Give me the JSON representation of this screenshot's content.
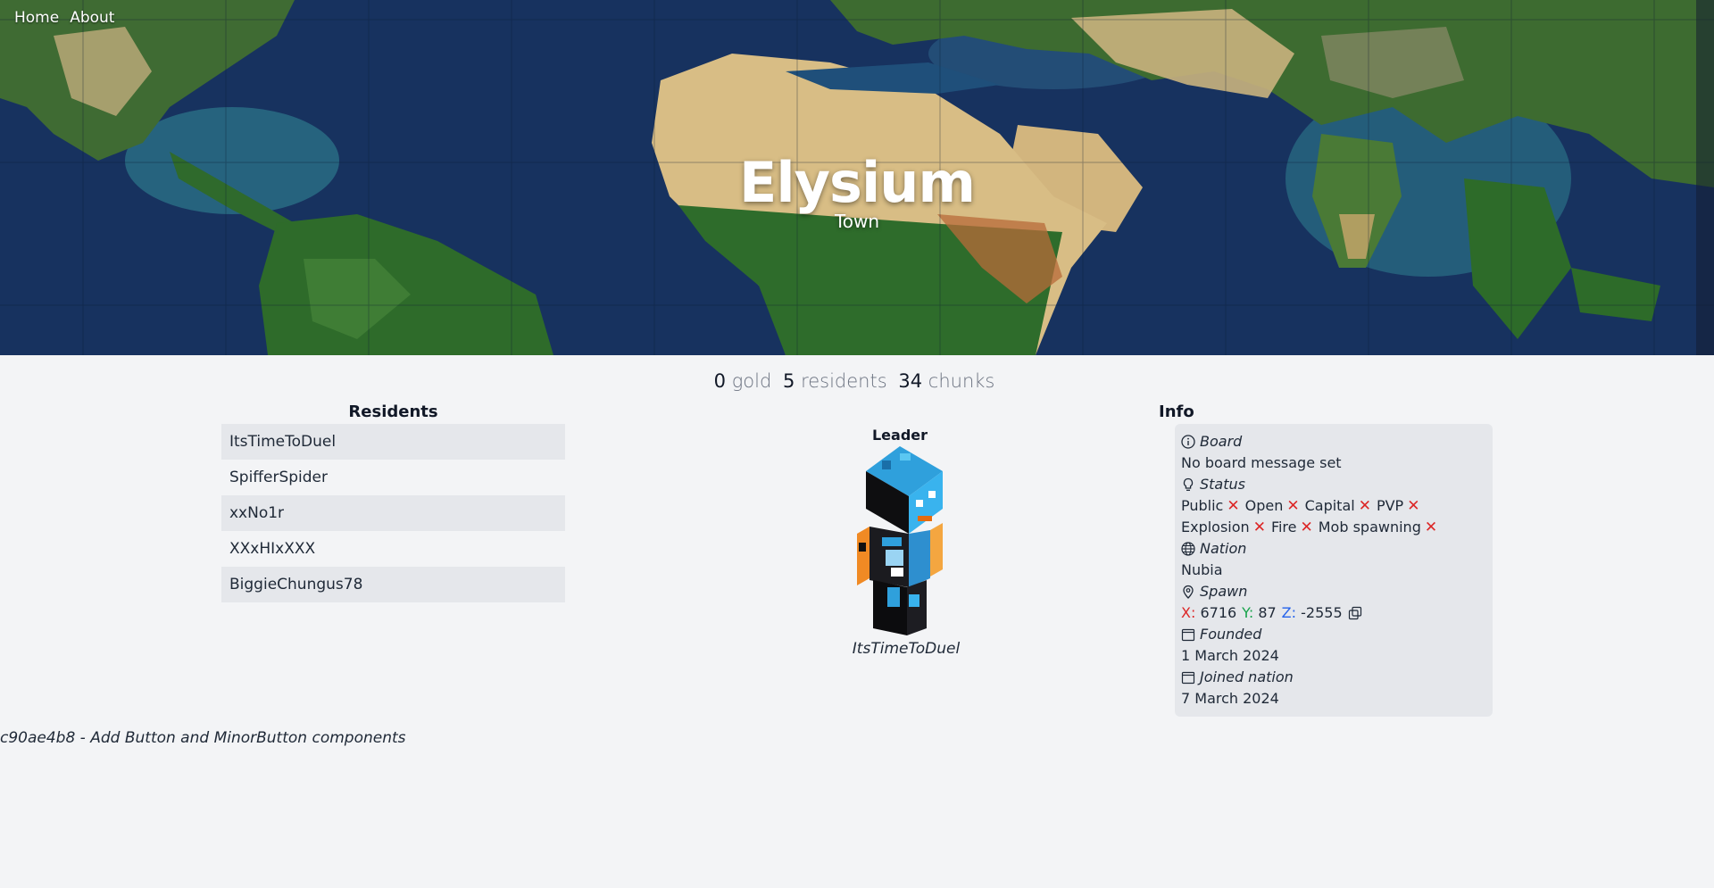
{
  "nav": {
    "home": "Home",
    "about": "About"
  },
  "hero": {
    "title": "Elysium",
    "subtitle": "Town"
  },
  "stats": {
    "gold_value": "0",
    "gold_label": "gold",
    "residents_value": "5",
    "residents_label": "residents",
    "chunks_value": "34",
    "chunks_label": "chunks"
  },
  "residents": {
    "title": "Residents",
    "items": [
      "ItsTimeToDuel",
      "SpifferSpider",
      "xxNo1r",
      "XXxHIxXXX",
      "BiggieChungus78"
    ]
  },
  "leader": {
    "title": "Leader",
    "name": "ItsTimeToDuel"
  },
  "info": {
    "title": "Info",
    "board_label": "Board",
    "board_value": "No board message set",
    "status_label": "Status",
    "flags": [
      "Public",
      "Open",
      "Capital",
      "PVP",
      "Explosion",
      "Fire",
      "Mob spawning"
    ],
    "nation_label": "Nation",
    "nation_value": "Nubia",
    "spawn_label": "Spawn",
    "spawn": {
      "x_label": "X:",
      "x": "6716",
      "y_label": "Y:",
      "y": "87",
      "z_label": "Z:",
      "z": "-2555"
    },
    "founded_label": "Founded",
    "founded_value": "1 March 2024",
    "joined_label": "Joined nation",
    "joined_value": "7 March 2024"
  },
  "footer": {
    "commit": "c90ae4b8 - Add Button and MinorButton components"
  },
  "icons": {
    "board": "info-circle-icon",
    "status": "lightbulb-icon",
    "nation": "globe-icon",
    "spawn": "map-pin-icon",
    "founded": "calendar-icon",
    "joined": "calendar-icon",
    "flag_off": "x-mark-icon",
    "copy": "copy-icon"
  },
  "colors": {
    "background": "#f3f4f6",
    "panel": "#e5e7eb",
    "x_red": "#dc2626",
    "y_green": "#16a34a",
    "z_blue": "#2563eb"
  }
}
